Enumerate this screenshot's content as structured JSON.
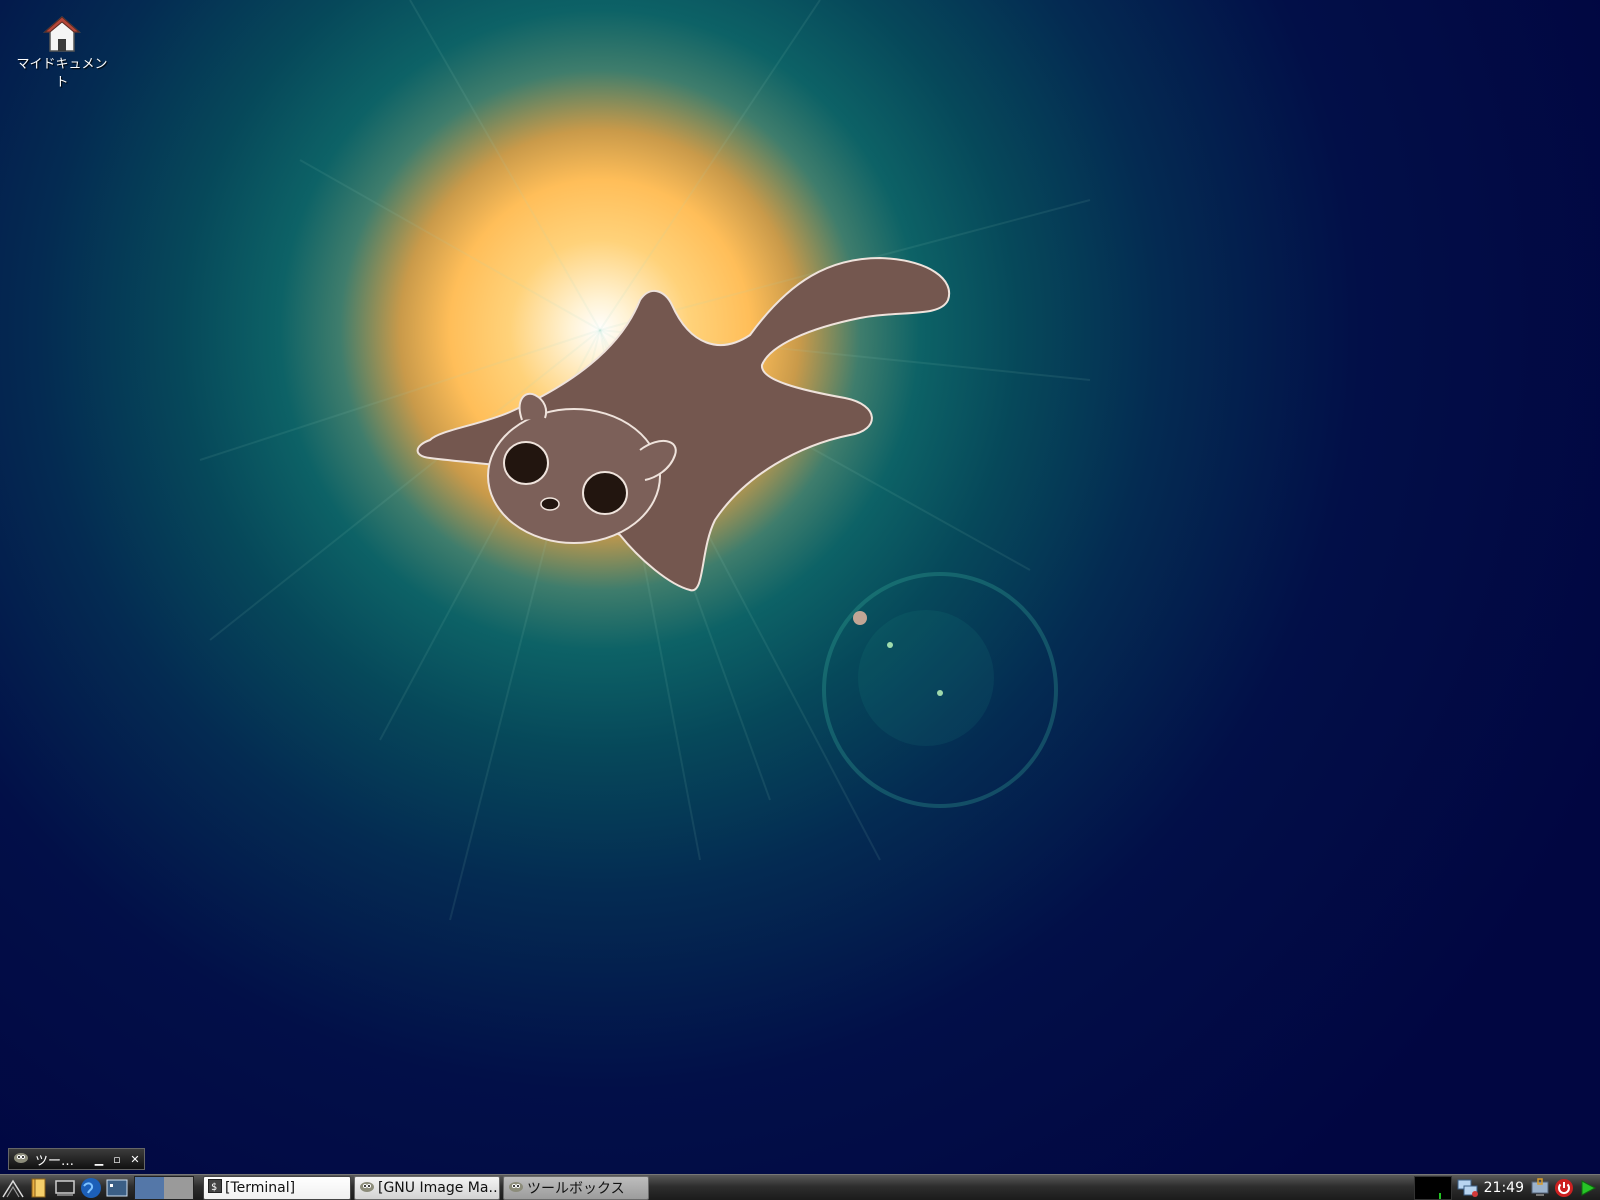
{
  "desktop": {
    "icons": [
      {
        "label": "マイドキュメント",
        "icon": "home-folder-icon"
      }
    ]
  },
  "mini_window": {
    "title": "ツー…",
    "buttons": [
      "minimize",
      "maximize",
      "close"
    ]
  },
  "taskbar": {
    "launchers": [
      "start-menu-icon",
      "file-manager-icon",
      "show-desktop-icon",
      "web-browser-icon",
      "terminal-icon"
    ],
    "pager": {
      "desktops": 2,
      "active": 1
    },
    "tasks": [
      {
        "label": "[Terminal]",
        "icon": "terminal-icon",
        "state": "active"
      },
      {
        "label": "[GNU Image Ma…",
        "icon": "gimp-icon",
        "state": "normal"
      },
      {
        "label": "ツールボックス",
        "icon": "gimp-icon",
        "state": "dim"
      }
    ],
    "tray": {
      "clock": "21:49",
      "icons": [
        "network-icon",
        "lock-screen-icon",
        "power-icon",
        "play-icon"
      ]
    }
  },
  "colors": {
    "panel_dark": "#1b1b1b",
    "pager_active": "#5477a8",
    "sun_core": "#ffbe59",
    "sky_dark": "#010641",
    "squirrel": "#74574f"
  }
}
